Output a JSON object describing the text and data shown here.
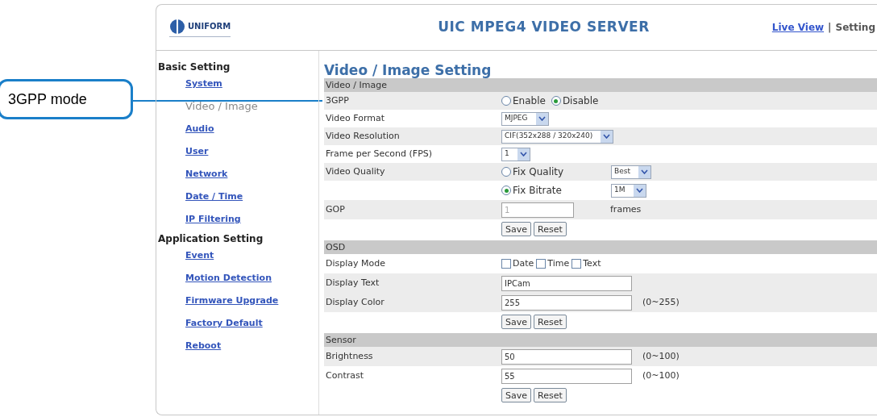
{
  "callout": {
    "text": "3GPP mode"
  },
  "header": {
    "logo_text": "UNIFORM",
    "title": "UIC MPEG4 VIDEO SERVER",
    "links": [
      {
        "label": "Live View",
        "selected": false
      },
      {
        "label": "Setting",
        "selected": true
      }
    ],
    "separator": "|"
  },
  "sidebar": [
    {
      "heading": "Basic Setting",
      "items": [
        {
          "label": "System",
          "selected": false
        },
        {
          "label": "Video / Image",
          "selected": true
        },
        {
          "label": "Audio",
          "selected": false
        },
        {
          "label": "User",
          "selected": false
        },
        {
          "label": "Network",
          "selected": false
        },
        {
          "label": "Date / Time",
          "selected": false
        },
        {
          "label": "IP Filtering",
          "selected": false
        }
      ]
    },
    {
      "heading": "Application Setting",
      "items": [
        {
          "label": "Event",
          "selected": false
        },
        {
          "label": "Motion Detection",
          "selected": false
        },
        {
          "label": "Firmware Upgrade",
          "selected": false
        },
        {
          "label": "Factory Default",
          "selected": false
        },
        {
          "label": "Reboot",
          "selected": false
        }
      ]
    }
  ],
  "page_title": "Video / Image Setting",
  "sections": [
    {
      "title": "Video / Image",
      "rows": [
        {
          "label": "3GPP",
          "shaded": true,
          "controls": [
            {
              "kind": "radio",
              "label": "Enable",
              "selected": false
            },
            {
              "kind": "radio",
              "label": "Disable",
              "selected": true
            }
          ]
        },
        {
          "label": "Video Format",
          "shaded": false,
          "controls": [
            {
              "kind": "select",
              "value": "MJPEG"
            }
          ]
        },
        {
          "label": "Video Resolution",
          "shaded": true,
          "controls": [
            {
              "kind": "select",
              "value": "CIF(352x288 / 320x240)"
            }
          ]
        },
        {
          "label": "Frame per Second (FPS)",
          "shaded": false,
          "controls": [
            {
              "kind": "select",
              "value": "1"
            }
          ]
        },
        {
          "label": "Video Quality",
          "shaded": true,
          "controls": [
            {
              "kind": "radio",
              "label": "Fix Quality",
              "selected": false
            },
            {
              "kind": "select",
              "value": "Best"
            }
          ]
        },
        {
          "shaded": false,
          "controls": [
            {
              "kind": "radio",
              "label": "Fix Bitrate",
              "selected": true
            },
            {
              "kind": "select",
              "value": "1M"
            }
          ]
        },
        {
          "label": "GOP",
          "shaded": true,
          "controls": [
            {
              "kind": "input",
              "value": "1",
              "disabled": true
            },
            {
              "kind": "text",
              "text": "frames"
            }
          ]
        },
        {
          "shaded": false,
          "controls": [
            {
              "kind": "button",
              "label": "Save"
            },
            {
              "kind": "button",
              "label": "Reset"
            }
          ]
        }
      ]
    },
    {
      "title": "OSD",
      "rows": [
        {
          "label": "Display Mode",
          "shaded": false,
          "controls": [
            {
              "kind": "checkbox",
              "label": "Date",
              "checked": false
            },
            {
              "kind": "checkbox",
              "label": "Time",
              "checked": false
            },
            {
              "kind": "checkbox",
              "label": "Text",
              "checked": false
            }
          ]
        },
        {
          "label": "Display Text",
          "shaded": true,
          "controls": [
            {
              "kind": "input",
              "value": "IPCam",
              "disabled": false
            }
          ]
        },
        {
          "label": "Display Color",
          "shaded": true,
          "controls": [
            {
              "kind": "input",
              "value": "255",
              "disabled": false
            },
            {
              "kind": "text",
              "text": "(0~255)"
            }
          ]
        },
        {
          "shaded": false,
          "controls": [
            {
              "kind": "button",
              "label": "Save"
            },
            {
              "kind": "button",
              "label": "Reset"
            }
          ]
        }
      ]
    },
    {
      "title": "Sensor",
      "rows": [
        {
          "label": "Brightness",
          "shaded": true,
          "controls": [
            {
              "kind": "input",
              "value": "50",
              "disabled": false
            },
            {
              "kind": "text",
              "text": "(0~100)"
            }
          ]
        },
        {
          "label": "Contrast",
          "shaded": false,
          "controls": [
            {
              "kind": "input",
              "value": "55",
              "disabled": false
            },
            {
              "kind": "text",
              "text": "(0~100)"
            }
          ]
        },
        {
          "shaded": false,
          "controls": [
            {
              "kind": "button",
              "label": "Save"
            },
            {
              "kind": "button",
              "label": "Reset"
            }
          ]
        }
      ]
    }
  ]
}
